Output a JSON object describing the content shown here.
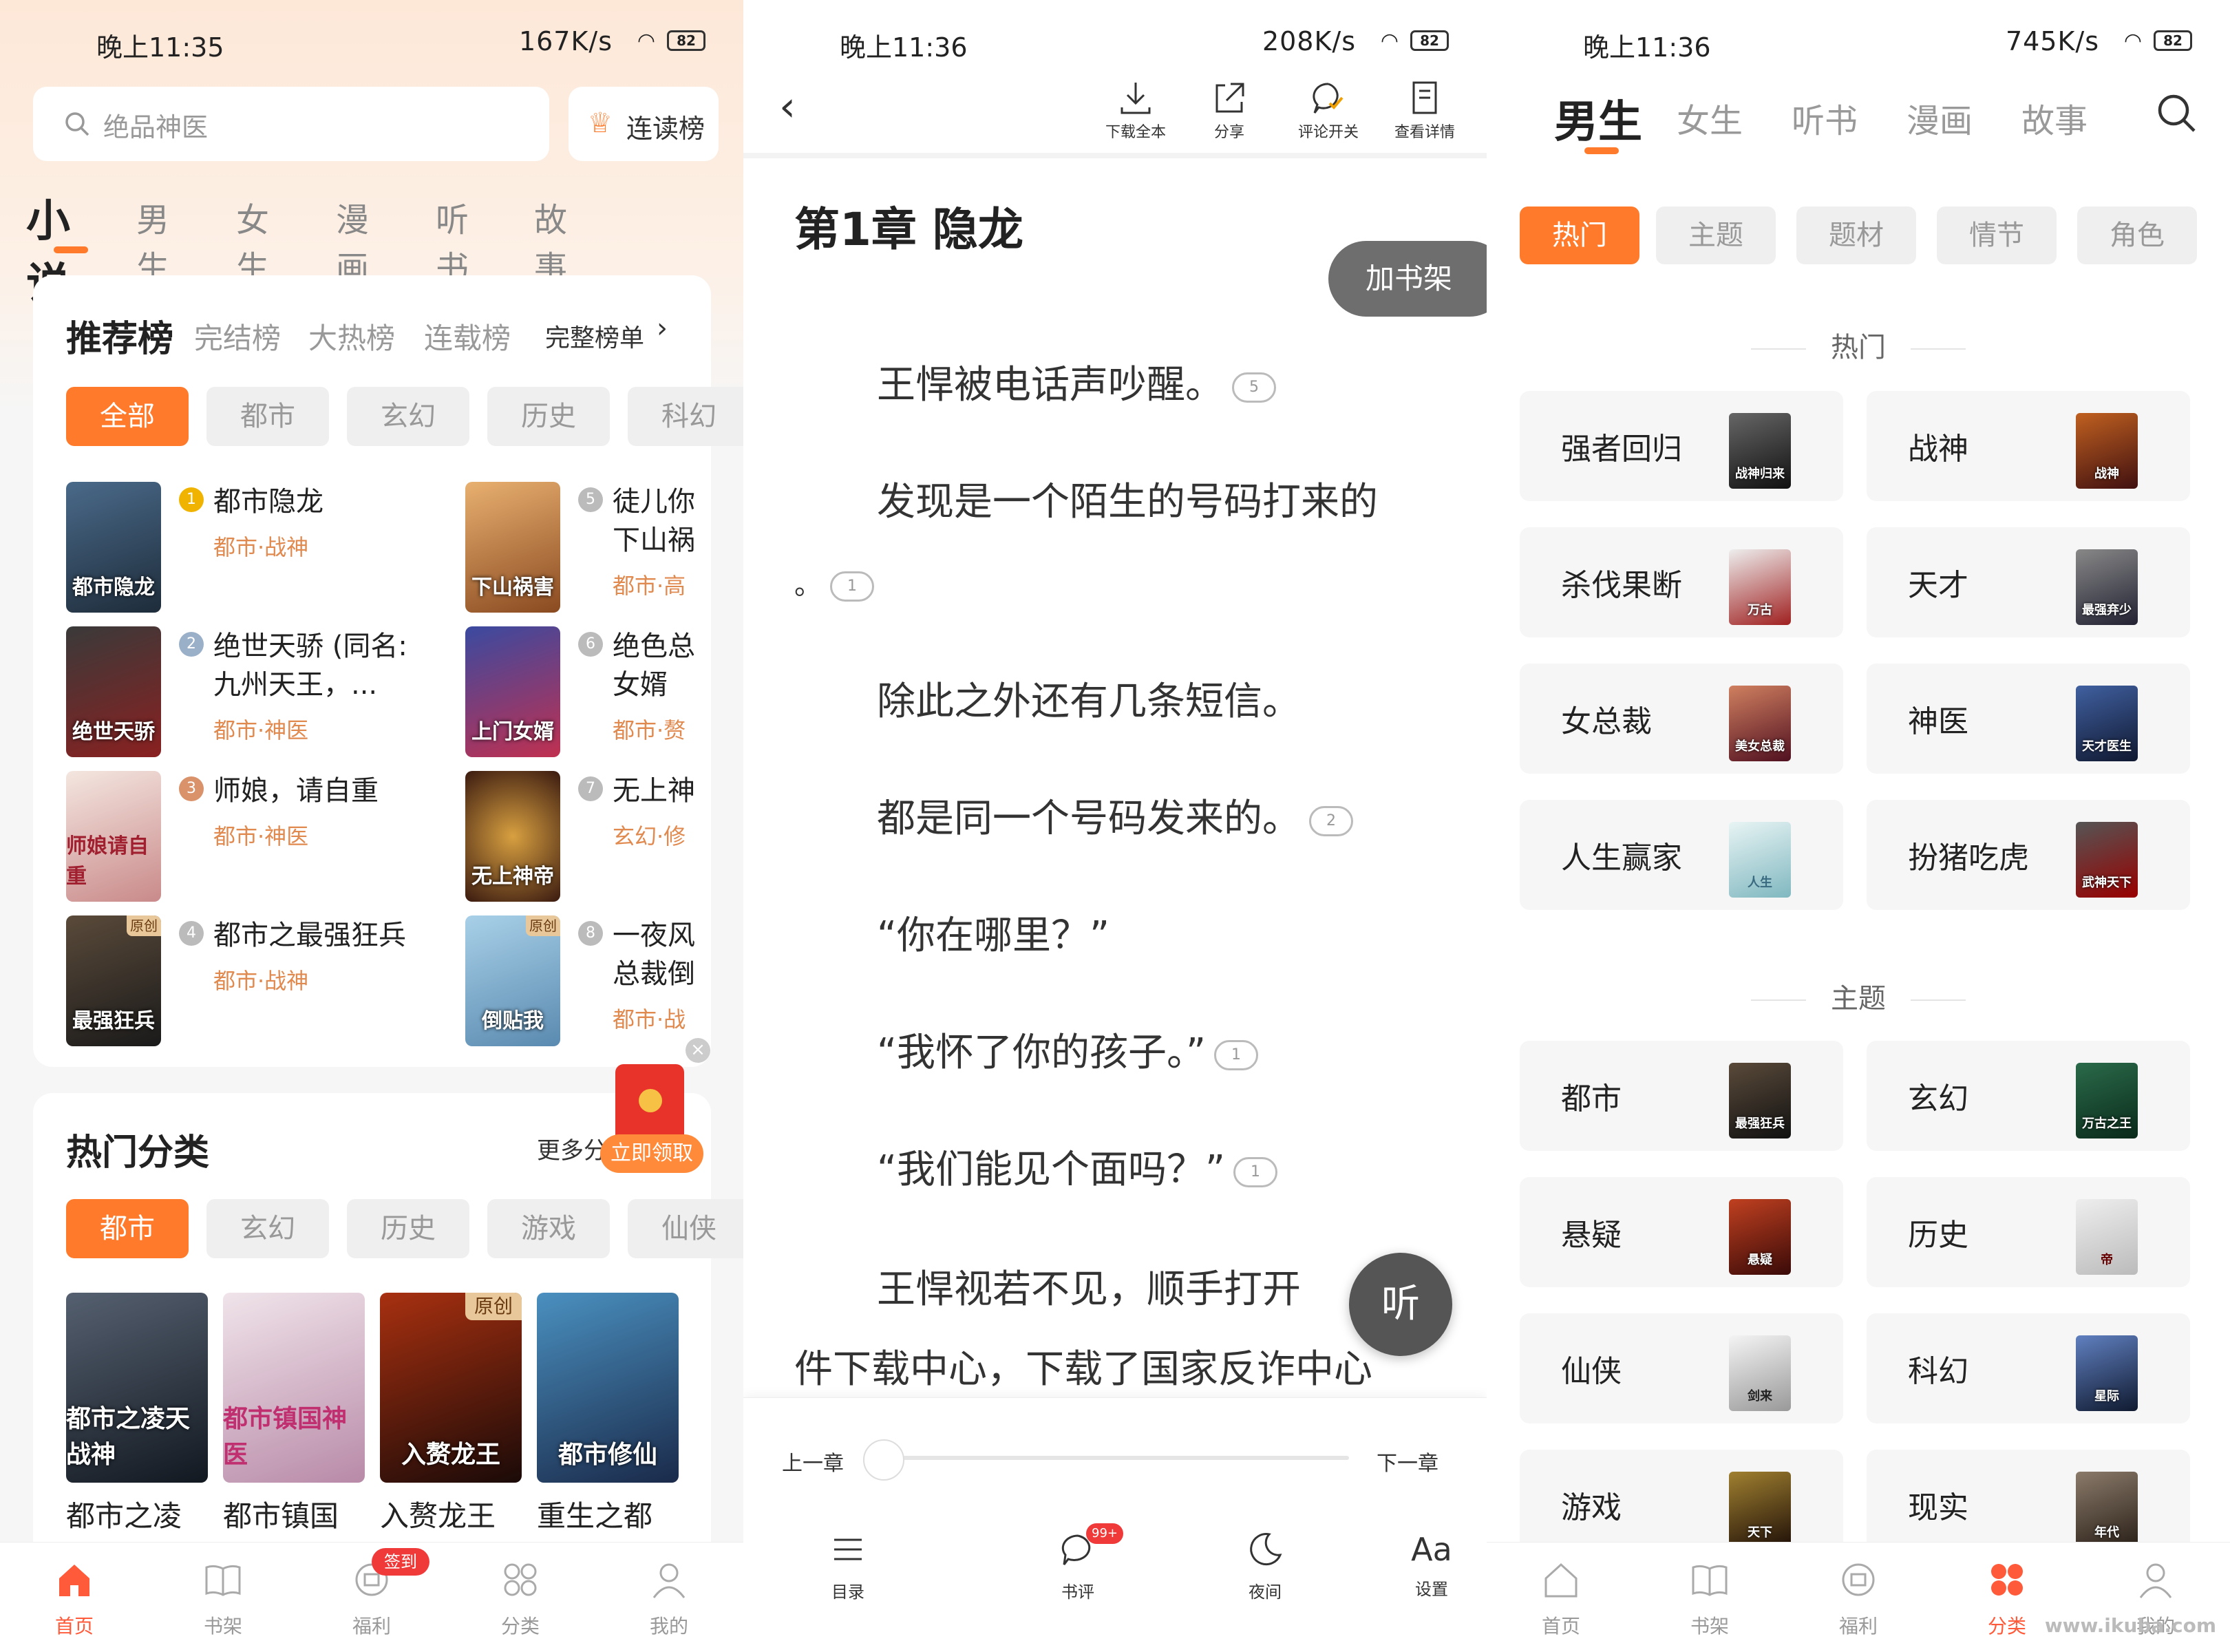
{
  "panel1": {
    "status": {
      "time": "晚上11:35",
      "net": "167K/s",
      "battery": "82"
    },
    "search": {
      "placeholder": "绝品神医"
    },
    "read_rank_label": "连读榜",
    "top_tabs": [
      "小说",
      "男生",
      "女生",
      "漫画",
      "听书",
      "故事"
    ],
    "rank_card": {
      "title": "推荐榜",
      "tabs": [
        "完结榜",
        "大热榜",
        "连载榜"
      ],
      "full_list": "完整榜单"
    },
    "rank_filters": [
      "全部",
      "都市",
      "玄幻",
      "历史",
      "科幻"
    ],
    "books": [
      {
        "rank": "1",
        "title": "都市隐龙",
        "subtitle": "都市·战神",
        "cover_text": "都市隐龙"
      },
      {
        "rank": "2",
        "title": "绝世天骄 (同名:",
        "title2": "九州天王，...",
        "subtitle": "都市·神医",
        "cover_text": "绝世天骄"
      },
      {
        "rank": "3",
        "title": "师娘，请自重",
        "subtitle": "都市·神医",
        "cover_text": "师娘请自重"
      },
      {
        "rank": "4",
        "title": "都市之最强狂兵",
        "subtitle": "都市·战神",
        "cover_text": "最强狂兵",
        "badge": "原创"
      },
      {
        "rank": "5",
        "title": "徒儿你",
        "title2": "下山祸",
        "subtitle": "都市·高",
        "cover_text": "下山祸害"
      },
      {
        "rank": "6",
        "title": "绝色总",
        "title2": "女婿",
        "subtitle": "都市·赘",
        "cover_text": "上门女婿"
      },
      {
        "rank": "7",
        "title": "无上神",
        "subtitle": "玄幻·修",
        "cover_text": "无上神帝"
      },
      {
        "rank": "8",
        "title": "一夜风",
        "title2": "总裁倒",
        "subtitle": "都市·战",
        "cover_text": "倒贴我",
        "badge": "原创"
      }
    ],
    "hot_cats": {
      "title": "热门分类",
      "more": "更多分",
      "filters": [
        "都市",
        "玄幻",
        "历史",
        "游戏",
        "仙侠"
      ]
    },
    "hot_books": [
      {
        "title": "都市之凌",
        "cover_text": "都市之凌天战神"
      },
      {
        "title": "都市镇国",
        "cover_text": "都市镇国神医"
      },
      {
        "title": "入赘龙王",
        "cover_text": "入赘龙王",
        "badge": "原创"
      },
      {
        "title": "重生之都",
        "cover_text": "都市修仙"
      }
    ],
    "redpacket": "立即领取",
    "nav": [
      {
        "label": "首页"
      },
      {
        "label": "书架"
      },
      {
        "label": "福利",
        "badge": "签到"
      },
      {
        "label": "分类"
      },
      {
        "label": "我的"
      }
    ]
  },
  "panel2": {
    "status": {
      "time": "晚上11:36",
      "net": "208K/s",
      "battery": "82"
    },
    "toolbar": [
      "下载全本",
      "分享",
      "评论开关",
      "查看详情"
    ],
    "chapter": "第1章 隐龙",
    "add_shelf": "加书架",
    "lines": [
      {
        "text": "王悍被电话声吵醒。",
        "count": "5"
      },
      {
        "text": "发现是一个陌生的号码打来的"
      },
      {
        "text": "。",
        "count": "1"
      },
      {
        "text": "除此之外还有几条短信。"
      },
      {
        "text": "都是同一个号码发来的。",
        "count": "2"
      },
      {
        "text": "“你在哪里？”"
      },
      {
        "text": "“我怀了你的孩子。”",
        "count": "1"
      },
      {
        "text": "“我们能见个面吗？”",
        "count": "1"
      },
      {
        "text": "王悍视若不见，顺手打开"
      },
      {
        "text": "件下载中心，下载了国家反诈中心"
      }
    ],
    "listen": "听",
    "prev": "上一章",
    "next": "下一章",
    "bottom": [
      {
        "label": "目录"
      },
      {
        "label": "书评",
        "badge": "99+"
      },
      {
        "label": "夜间"
      },
      {
        "label": "设置"
      }
    ]
  },
  "panel3": {
    "status": {
      "time": "晚上11:36",
      "net": "745K/s",
      "battery": "82"
    },
    "top_tabs": [
      "男生",
      "女生",
      "听书",
      "漫画",
      "故事"
    ],
    "sub_tabs": [
      "热门",
      "主题",
      "题材",
      "情节",
      "角色"
    ],
    "hot_title": "热门",
    "hot": [
      {
        "name": "强者回归",
        "thumb": "战神归来"
      },
      {
        "name": "战神",
        "thumb": "战神"
      },
      {
        "name": "杀伐果断",
        "thumb": "万古"
      },
      {
        "name": "天才",
        "thumb": "最强弃少"
      },
      {
        "name": "女总裁",
        "thumb": "美女总裁"
      },
      {
        "name": "神医",
        "thumb": "天才医生"
      },
      {
        "name": "人生赢家",
        "thumb": "人生"
      },
      {
        "name": "扮猪吃虎",
        "thumb": "武神天下"
      }
    ],
    "theme_title": "主题",
    "themes": [
      {
        "name": "都市",
        "thumb": "最强狂兵"
      },
      {
        "name": "玄幻",
        "thumb": "万古之王"
      },
      {
        "name": "悬疑",
        "thumb": "悬疑"
      },
      {
        "name": "历史",
        "thumb": "帝"
      },
      {
        "name": "仙侠",
        "thumb": "剑来"
      },
      {
        "name": "科幻",
        "thumb": "星际"
      },
      {
        "name": "游戏",
        "thumb": "天下"
      },
      {
        "name": "现实",
        "thumb": "年代"
      }
    ],
    "nav": [
      {
        "label": "首页"
      },
      {
        "label": "书架"
      },
      {
        "label": "福利"
      },
      {
        "label": "分类"
      },
      {
        "label": "我的"
      }
    ],
    "watermark": "www.ikuba.com"
  },
  "colors": {
    "accent": "#ff7a2a",
    "nav_active": "#ff5a3a"
  }
}
